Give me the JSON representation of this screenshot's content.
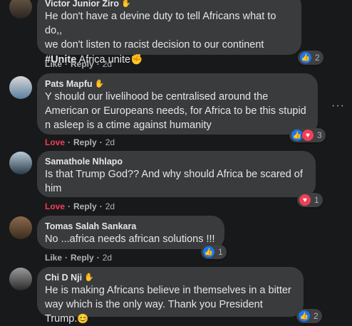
{
  "comments": [
    {
      "author": "Victor Junior Ziro",
      "line1": "He don't have a devine duty to tell Africans what to do,,",
      "line2": "we don't listen to racist decision to our continent",
      "hashtag": "#Unite",
      "line3_rest": " Africa unite",
      "action1": "Like",
      "action2": "Reply",
      "time": "2d",
      "reaction_count": "2"
    },
    {
      "author": "Pats Mapfu",
      "line1": "Y should our livelihood be centralised around the",
      "line2": "American or Europeans needs, for Africa to be this stupid",
      "line3": "n asleep is a ctime against humanity",
      "action1": "Love",
      "action2": "Reply",
      "time": "2d",
      "reaction_count": "3"
    },
    {
      "author": "Samathole Nhlapo",
      "line1": "Is that Trump God?? And why should Africa be scared of",
      "line2": "him",
      "action1": "Love",
      "action2": "Reply",
      "time": "2d",
      "reaction_count": "1"
    },
    {
      "author": "Tomas Salah Sankara",
      "line1": "No ...africa needs african solutions !!!",
      "action1": "Like",
      "action2": "Reply",
      "time": "2d",
      "reaction_count": "1"
    },
    {
      "author": "Chi D Nji",
      "line1": "He is making Africans believe in themselves in a bitter",
      "line2": "way which is the only way. Thank you President Trump.",
      "reaction_count": "2"
    }
  ],
  "more_options": "···",
  "separator": "·",
  "icons": {
    "like": "thumbs-up-icon",
    "love": "heart-icon",
    "wave": "wave-icon",
    "fist": "raised-fist-emoji",
    "smile": "smile-emoji"
  },
  "colors": {
    "background": "#18191a",
    "bubble": "#3a3b3c",
    "like_blue": "#1877f2",
    "love_red": "#f33e58"
  }
}
